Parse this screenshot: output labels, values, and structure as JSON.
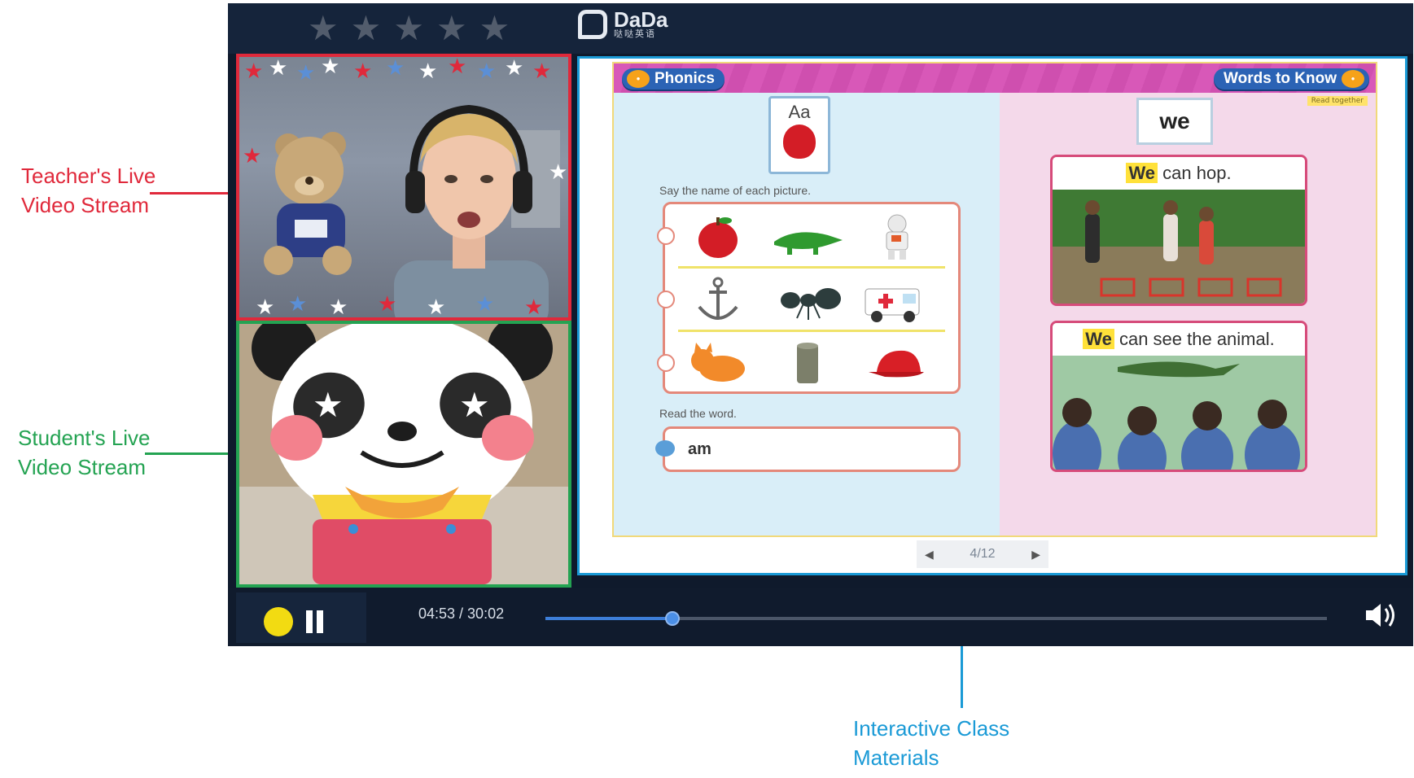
{
  "annotations": {
    "teacher": [
      "Teacher's Live",
      "Video Stream"
    ],
    "student": [
      "Student's Live",
      "Video Stream"
    ],
    "materials": [
      "Interactive Class",
      "Materials"
    ]
  },
  "player": {
    "rating_stars": 5,
    "logo": {
      "name": "DaDa",
      "subtitle": "哒哒英语"
    }
  },
  "lesson": {
    "left_tab": "Phonics",
    "right_tab": "Words to Know",
    "read_together": "Read together",
    "letter_card": "Aa",
    "instruction_1": "Say the name of each picture.",
    "instruction_2": "Read the word.",
    "word": "am",
    "sight_word": "we",
    "captions": [
      {
        "highlight": "We",
        "rest": " can hop."
      },
      {
        "highlight": "We",
        "rest": " can see the animal."
      }
    ],
    "pictures": [
      "apple",
      "alligator",
      "astronaut",
      "anchor",
      "ant",
      "ambulance",
      "cat",
      "can",
      "cap"
    ]
  },
  "pager": {
    "text": "4/12"
  },
  "playback": {
    "time": "04:53 / 30:02",
    "progress": 0.163
  },
  "colors": {
    "teacher": "#e0293b",
    "student": "#24a352",
    "materials": "#1a9ad6"
  }
}
